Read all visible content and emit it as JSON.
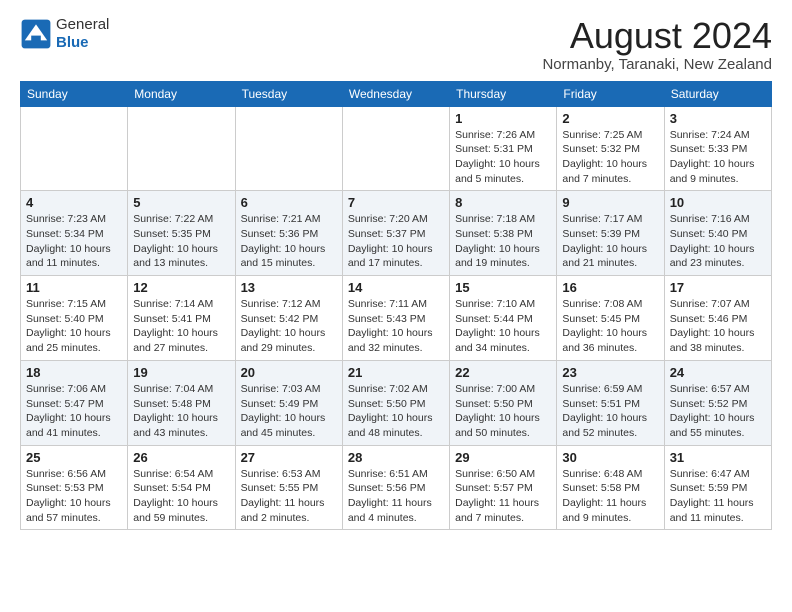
{
  "header": {
    "logo_line1": "General",
    "logo_line2": "Blue",
    "month_title": "August 2024",
    "location": "Normanby, Taranaki, New Zealand"
  },
  "weekdays": [
    "Sunday",
    "Monday",
    "Tuesday",
    "Wednesday",
    "Thursday",
    "Friday",
    "Saturday"
  ],
  "weeks": [
    [
      {
        "day": "",
        "info": ""
      },
      {
        "day": "",
        "info": ""
      },
      {
        "day": "",
        "info": ""
      },
      {
        "day": "",
        "info": ""
      },
      {
        "day": "1",
        "info": "Sunrise: 7:26 AM\nSunset: 5:31 PM\nDaylight: 10 hours\nand 5 minutes."
      },
      {
        "day": "2",
        "info": "Sunrise: 7:25 AM\nSunset: 5:32 PM\nDaylight: 10 hours\nand 7 minutes."
      },
      {
        "day": "3",
        "info": "Sunrise: 7:24 AM\nSunset: 5:33 PM\nDaylight: 10 hours\nand 9 minutes."
      }
    ],
    [
      {
        "day": "4",
        "info": "Sunrise: 7:23 AM\nSunset: 5:34 PM\nDaylight: 10 hours\nand 11 minutes."
      },
      {
        "day": "5",
        "info": "Sunrise: 7:22 AM\nSunset: 5:35 PM\nDaylight: 10 hours\nand 13 minutes."
      },
      {
        "day": "6",
        "info": "Sunrise: 7:21 AM\nSunset: 5:36 PM\nDaylight: 10 hours\nand 15 minutes."
      },
      {
        "day": "7",
        "info": "Sunrise: 7:20 AM\nSunset: 5:37 PM\nDaylight: 10 hours\nand 17 minutes."
      },
      {
        "day": "8",
        "info": "Sunrise: 7:18 AM\nSunset: 5:38 PM\nDaylight: 10 hours\nand 19 minutes."
      },
      {
        "day": "9",
        "info": "Sunrise: 7:17 AM\nSunset: 5:39 PM\nDaylight: 10 hours\nand 21 minutes."
      },
      {
        "day": "10",
        "info": "Sunrise: 7:16 AM\nSunset: 5:40 PM\nDaylight: 10 hours\nand 23 minutes."
      }
    ],
    [
      {
        "day": "11",
        "info": "Sunrise: 7:15 AM\nSunset: 5:40 PM\nDaylight: 10 hours\nand 25 minutes."
      },
      {
        "day": "12",
        "info": "Sunrise: 7:14 AM\nSunset: 5:41 PM\nDaylight: 10 hours\nand 27 minutes."
      },
      {
        "day": "13",
        "info": "Sunrise: 7:12 AM\nSunset: 5:42 PM\nDaylight: 10 hours\nand 29 minutes."
      },
      {
        "day": "14",
        "info": "Sunrise: 7:11 AM\nSunset: 5:43 PM\nDaylight: 10 hours\nand 32 minutes."
      },
      {
        "day": "15",
        "info": "Sunrise: 7:10 AM\nSunset: 5:44 PM\nDaylight: 10 hours\nand 34 minutes."
      },
      {
        "day": "16",
        "info": "Sunrise: 7:08 AM\nSunset: 5:45 PM\nDaylight: 10 hours\nand 36 minutes."
      },
      {
        "day": "17",
        "info": "Sunrise: 7:07 AM\nSunset: 5:46 PM\nDaylight: 10 hours\nand 38 minutes."
      }
    ],
    [
      {
        "day": "18",
        "info": "Sunrise: 7:06 AM\nSunset: 5:47 PM\nDaylight: 10 hours\nand 41 minutes."
      },
      {
        "day": "19",
        "info": "Sunrise: 7:04 AM\nSunset: 5:48 PM\nDaylight: 10 hours\nand 43 minutes."
      },
      {
        "day": "20",
        "info": "Sunrise: 7:03 AM\nSunset: 5:49 PM\nDaylight: 10 hours\nand 45 minutes."
      },
      {
        "day": "21",
        "info": "Sunrise: 7:02 AM\nSunset: 5:50 PM\nDaylight: 10 hours\nand 48 minutes."
      },
      {
        "day": "22",
        "info": "Sunrise: 7:00 AM\nSunset: 5:50 PM\nDaylight: 10 hours\nand 50 minutes."
      },
      {
        "day": "23",
        "info": "Sunrise: 6:59 AM\nSunset: 5:51 PM\nDaylight: 10 hours\nand 52 minutes."
      },
      {
        "day": "24",
        "info": "Sunrise: 6:57 AM\nSunset: 5:52 PM\nDaylight: 10 hours\nand 55 minutes."
      }
    ],
    [
      {
        "day": "25",
        "info": "Sunrise: 6:56 AM\nSunset: 5:53 PM\nDaylight: 10 hours\nand 57 minutes."
      },
      {
        "day": "26",
        "info": "Sunrise: 6:54 AM\nSunset: 5:54 PM\nDaylight: 10 hours\nand 59 minutes."
      },
      {
        "day": "27",
        "info": "Sunrise: 6:53 AM\nSunset: 5:55 PM\nDaylight: 11 hours\nand 2 minutes."
      },
      {
        "day": "28",
        "info": "Sunrise: 6:51 AM\nSunset: 5:56 PM\nDaylight: 11 hours\nand 4 minutes."
      },
      {
        "day": "29",
        "info": "Sunrise: 6:50 AM\nSunset: 5:57 PM\nDaylight: 11 hours\nand 7 minutes."
      },
      {
        "day": "30",
        "info": "Sunrise: 6:48 AM\nSunset: 5:58 PM\nDaylight: 11 hours\nand 9 minutes."
      },
      {
        "day": "31",
        "info": "Sunrise: 6:47 AM\nSunset: 5:59 PM\nDaylight: 11 hours\nand 11 minutes."
      }
    ]
  ]
}
